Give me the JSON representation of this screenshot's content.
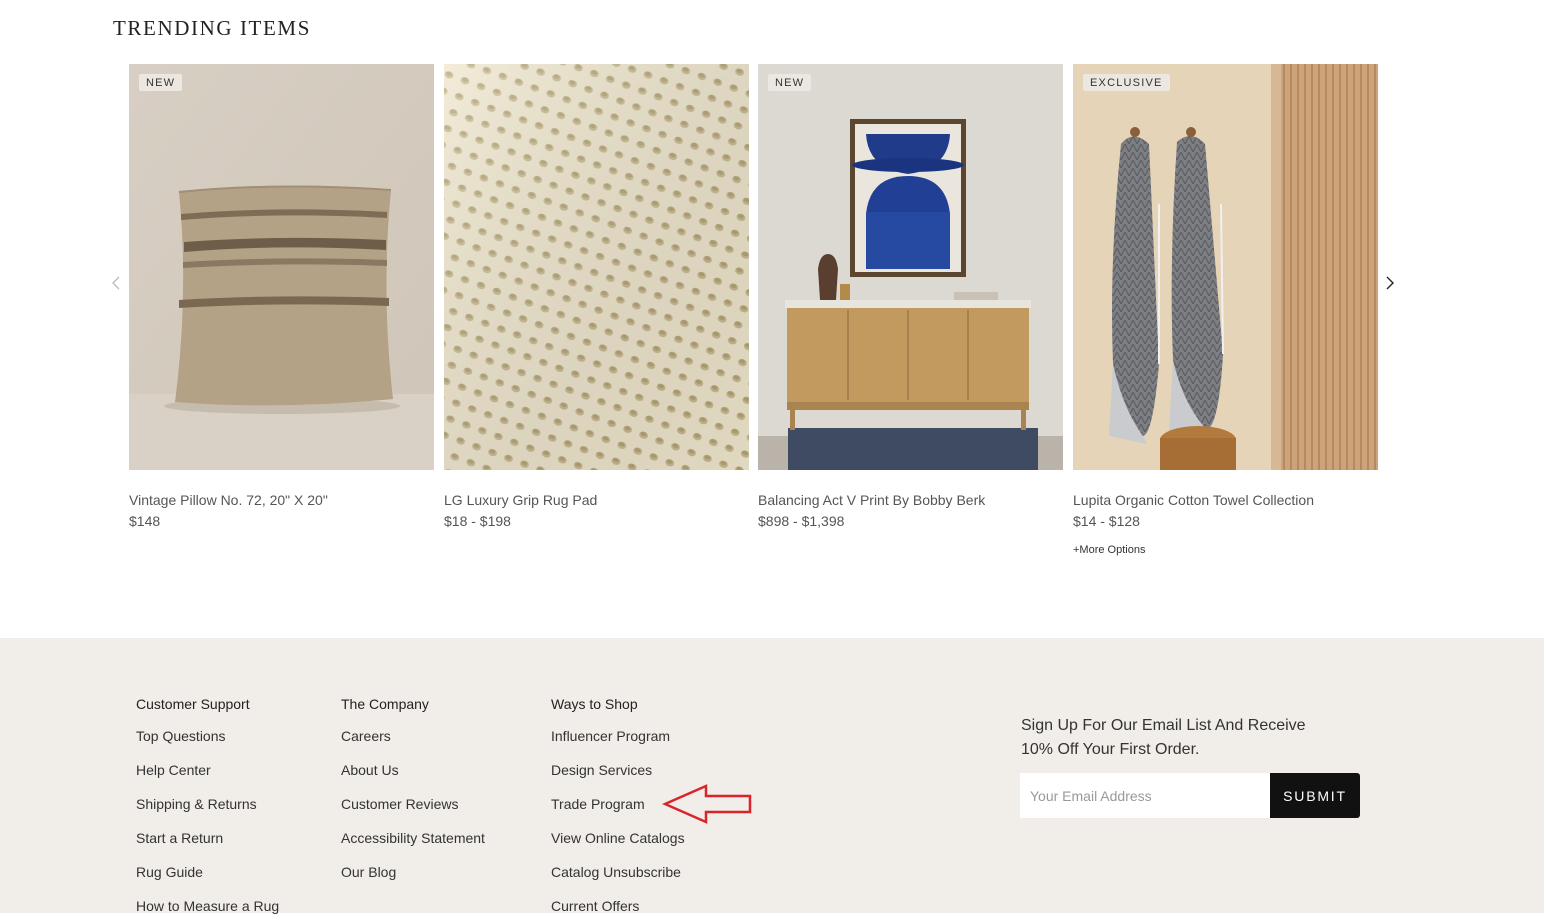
{
  "trending": {
    "title": "TRENDING ITEMS",
    "products": [
      {
        "name": "Vintage Pillow No. 72, 20\" X 20\"",
        "price": "$148",
        "badge": "NEW"
      },
      {
        "name": "LG Luxury Grip Rug Pad",
        "price": "$18 - $198",
        "badge": ""
      },
      {
        "name": "Balancing Act V Print By Bobby Berk",
        "price": "$898 - $1,398",
        "badge": "NEW"
      },
      {
        "name": "Lupita Organic Cotton Towel Collection",
        "price": "$14 - $128",
        "badge": "EXCLUSIVE",
        "more_options": "+More Options"
      }
    ],
    "prev_icon": "chevron-left-icon",
    "next_icon": "chevron-right-icon"
  },
  "footer": {
    "columns": [
      {
        "heading": "Customer Support",
        "links": [
          "Top Questions",
          "Help Center",
          "Shipping & Returns",
          "Start a Return",
          "Rug Guide",
          "How to Measure a Rug"
        ]
      },
      {
        "heading": "The Company",
        "links": [
          "Careers",
          "About Us",
          "Customer Reviews",
          "Accessibility Statement",
          "Our Blog"
        ]
      },
      {
        "heading": "Ways to Shop",
        "links": [
          "Influencer Program",
          "Design Services",
          "Trade Program",
          "View Online Catalogs",
          "Catalog Unsubscribe",
          "Current Offers"
        ]
      }
    ],
    "signup": {
      "text": "Sign Up For Our Email List And Receive 10% Off Your First Order.",
      "placeholder": "Your Email Address",
      "submit_label": "SUBMIT"
    }
  },
  "colors": {
    "footer_bg": "#f1ede8",
    "submit_bg": "#111111",
    "annotation_arrow": "#d9242b"
  }
}
